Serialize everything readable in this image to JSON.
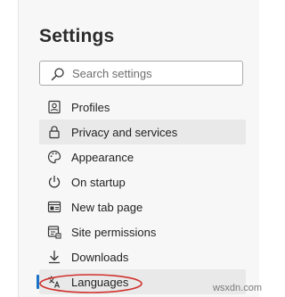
{
  "header": {
    "title": "Settings"
  },
  "search": {
    "placeholder": "Search settings",
    "icon": "search-icon"
  },
  "nav": {
    "items": [
      {
        "label": "Profiles",
        "icon": "profile-icon"
      },
      {
        "label": "Privacy and services",
        "icon": "lock-icon",
        "state": "hover"
      },
      {
        "label": "Appearance",
        "icon": "palette-icon"
      },
      {
        "label": "On startup",
        "icon": "power-icon"
      },
      {
        "label": "New tab page",
        "icon": "new-tab-icon"
      },
      {
        "label": "Site permissions",
        "icon": "site-permissions-icon"
      },
      {
        "label": "Downloads",
        "icon": "download-icon"
      },
      {
        "label": "Languages",
        "icon": "languages-icon",
        "state": "selected"
      }
    ]
  },
  "annotation": {
    "shape": "ellipse",
    "target": "Languages",
    "color": "#d0312d"
  },
  "colors": {
    "accent": "#1a73c8",
    "selection_bg": "#e9e9e9",
    "panel_bg": "#f7f7f7"
  },
  "watermark": {
    "text": "wsxdn.com"
  }
}
